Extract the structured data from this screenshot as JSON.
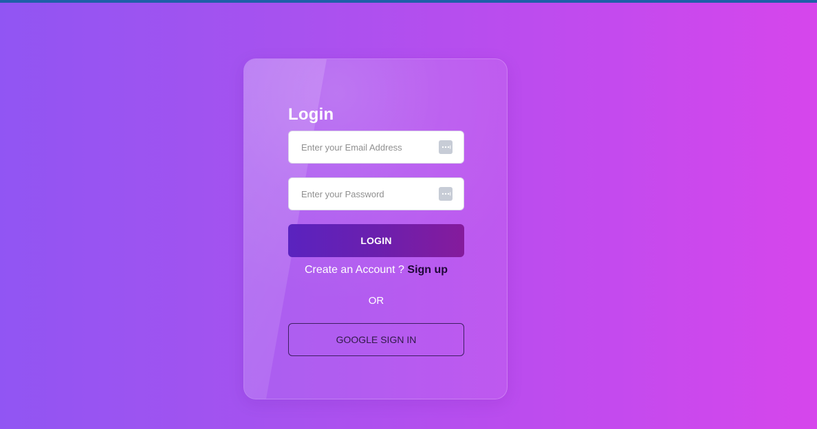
{
  "page": {
    "top_bar_color": "#1f5fa8",
    "background_start": "#9155f3",
    "background_end": "#d646ec"
  },
  "login_card": {
    "title": "Login",
    "email": {
      "placeholder": "Enter your Email Address",
      "value": "",
      "icon": "password-manager-icon"
    },
    "password": {
      "placeholder": "Enter your Password",
      "value": "",
      "icon": "password-manager-icon"
    },
    "login_button_label": "LOGIN",
    "signup_prompt": "Create an Account ?",
    "signup_link": "Sign up",
    "or_label": "OR",
    "google_button_label": "GOOGLE SIGN IN"
  }
}
